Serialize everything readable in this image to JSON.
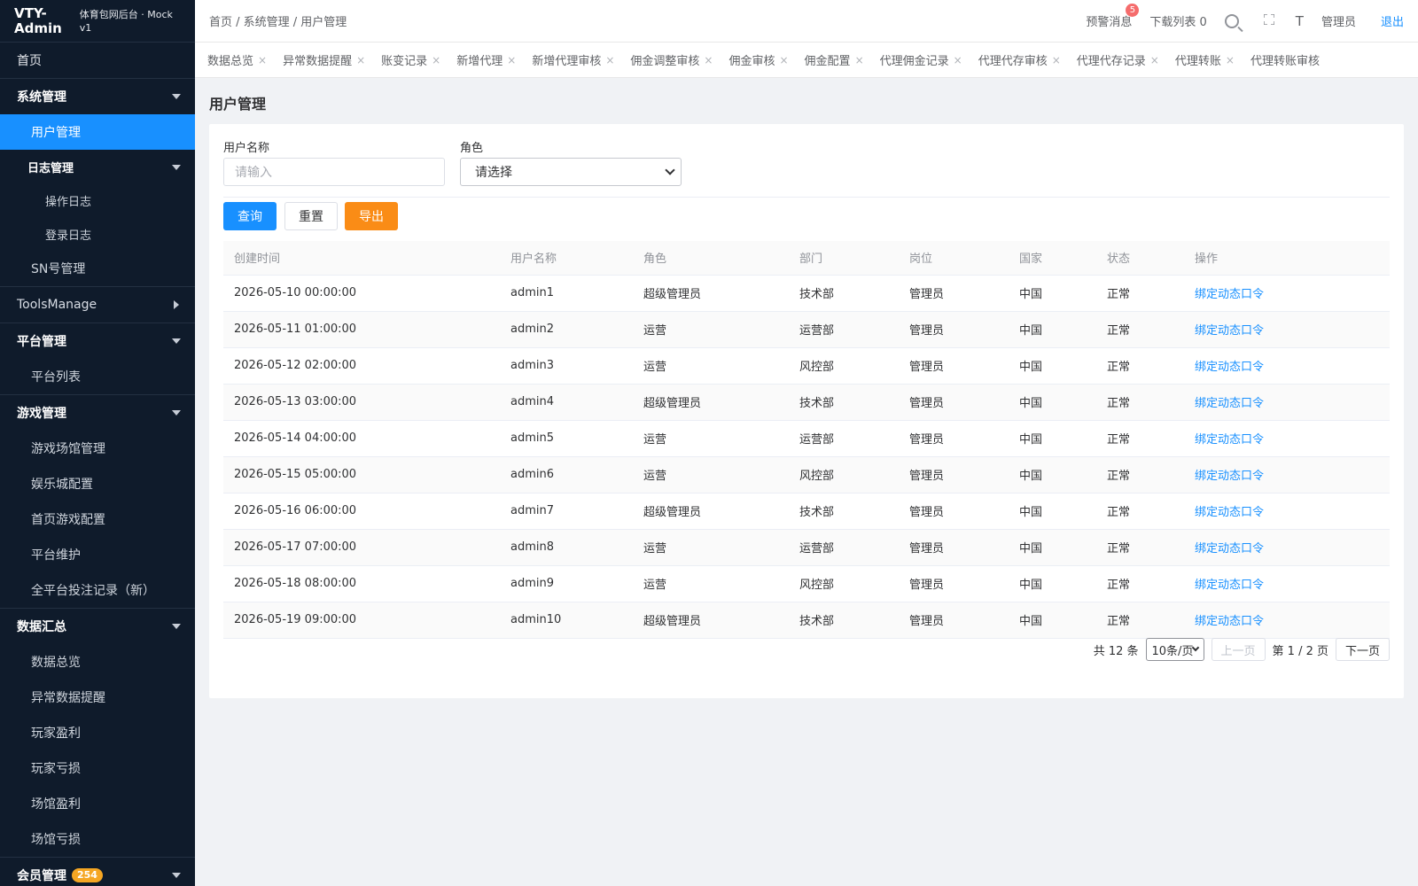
{
  "app": {
    "title": "VTY-Admin",
    "subtitle": "体育包网后台 · Mock v1"
  },
  "sidebar": {
    "home": "首页",
    "system": {
      "label": "系统管理",
      "user_mgmt": "用户管理",
      "log_mgmt": "日志管理",
      "op_log": "操作日志",
      "login_log": "登录日志",
      "sn_mgmt": "SN号管理"
    },
    "tools": "ToolsManage",
    "platform": {
      "label": "平台管理",
      "list": "平台列表"
    },
    "game": {
      "label": "游戏管理",
      "items": [
        "游戏场馆管理",
        "娱乐城配置",
        "首页游戏配置",
        "平台维护",
        "全平台投注记录（新）"
      ]
    },
    "data": {
      "label": "数据汇总",
      "items": [
        "数据总览",
        "异常数据提醒",
        "玩家盈利",
        "玩家亏损",
        "场馆盈利",
        "场馆亏损"
      ]
    },
    "member": {
      "label": "会员管理",
      "badge": "254"
    }
  },
  "header": {
    "breadcrumb": "首页 / 系统管理 / 用户管理",
    "alerts": "预警消息",
    "alerts_count": "5",
    "downloads": "下载列表 0",
    "font_icon": "T",
    "user": "管理员",
    "logout": "退出"
  },
  "tabs": [
    "数据总览",
    "异常数据提醒",
    "账变记录",
    "新增代理",
    "新增代理审核",
    "佣金调整审核",
    "佣金审核",
    "佣金配置",
    "代理佣金记录",
    "代理代存审核",
    "代理代存记录",
    "代理转账",
    "代理转账审核"
  ],
  "page": {
    "title": "用户管理"
  },
  "filters": {
    "username_label": "用户名称",
    "username_placeholder": "请输入",
    "role_label": "角色",
    "role_value": "请选择"
  },
  "buttons": {
    "query": "查询",
    "reset": "重置",
    "export": "导出"
  },
  "table": {
    "headers": [
      "创建时间",
      "用户名称",
      "角色",
      "部门",
      "岗位",
      "国家",
      "状态",
      "操作"
    ],
    "rows": [
      [
        "2026-05-10 00:00:00",
        "admin1",
        "超级管理员",
        "技术部",
        "管理员",
        "中国",
        "正常",
        "绑定动态口令"
      ],
      [
        "2026-05-11 01:00:00",
        "admin2",
        "运营",
        "运营部",
        "管理员",
        "中国",
        "正常",
        "绑定动态口令"
      ],
      [
        "2026-05-12 02:00:00",
        "admin3",
        "运营",
        "风控部",
        "管理员",
        "中国",
        "正常",
        "绑定动态口令"
      ],
      [
        "2026-05-13 03:00:00",
        "admin4",
        "超级管理员",
        "技术部",
        "管理员",
        "中国",
        "正常",
        "绑定动态口令"
      ],
      [
        "2026-05-14 04:00:00",
        "admin5",
        "运营",
        "运营部",
        "管理员",
        "中国",
        "正常",
        "绑定动态口令"
      ],
      [
        "2026-05-15 05:00:00",
        "admin6",
        "运营",
        "风控部",
        "管理员",
        "中国",
        "正常",
        "绑定动态口令"
      ],
      [
        "2026-05-16 06:00:00",
        "admin7",
        "超级管理员",
        "技术部",
        "管理员",
        "中国",
        "正常",
        "绑定动态口令"
      ],
      [
        "2026-05-17 07:00:00",
        "admin8",
        "运营",
        "运营部",
        "管理员",
        "中国",
        "正常",
        "绑定动态口令"
      ],
      [
        "2026-05-18 08:00:00",
        "admin9",
        "运营",
        "风控部",
        "管理员",
        "中国",
        "正常",
        "绑定动态口令"
      ],
      [
        "2026-05-19 09:00:00",
        "admin10",
        "超级管理员",
        "技术部",
        "管理员",
        "中国",
        "正常",
        "绑定动态口令"
      ]
    ]
  },
  "pagination": {
    "total": "共 12 条",
    "page_size": "10条/页",
    "prev": "上一页",
    "current": "第 1 / 2 页",
    "next": "下一页"
  },
  "colors": {
    "sidebar_bg": "#0f1b2b",
    "primary": "#1890ff",
    "warning": "#fa8c16",
    "badge": "#f5a623",
    "danger": "#f56c6c"
  }
}
